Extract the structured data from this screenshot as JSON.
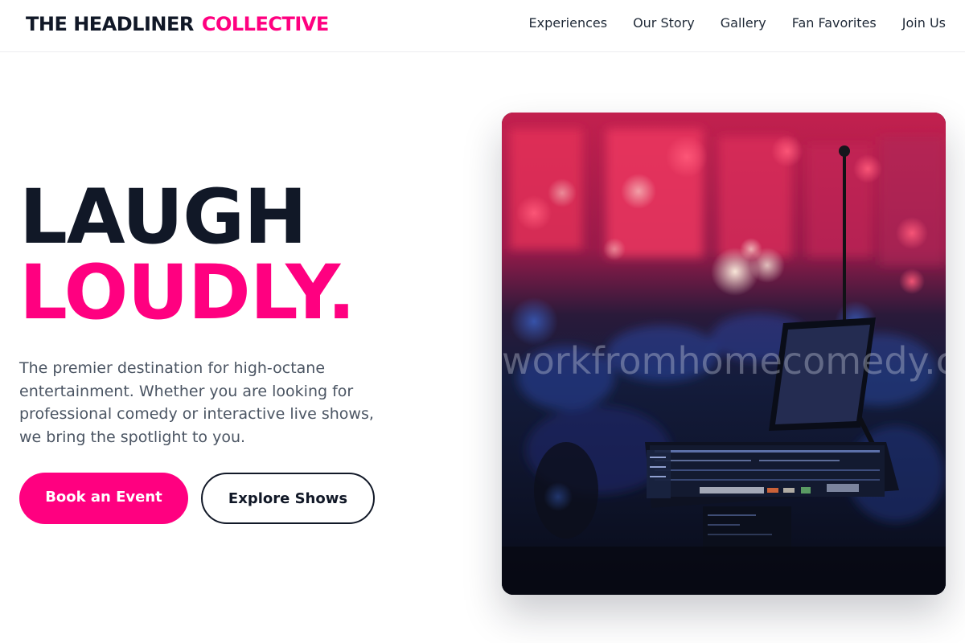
{
  "brand": {
    "name_primary": "THE HEADLINER",
    "name_accent": "COLLECTIVE",
    "accent_color": "#ff0080",
    "text_color": "#111827"
  },
  "nav": {
    "items": [
      {
        "label": "Experiences"
      },
      {
        "label": "Our Story"
      },
      {
        "label": "Gallery"
      },
      {
        "label": "Fan Favorites"
      },
      {
        "label": "Join Us"
      }
    ]
  },
  "hero": {
    "headline_line1": "LAUGH",
    "headline_line2": "LOUDLY.",
    "description": "The premier destination for high-octane entertainment. Whether you are looking for professional comedy or interactive live shows, we bring the spotlight to you.",
    "primary_button": "Book an Event",
    "secondary_button": "Explore Shows",
    "image_watermark": "workfromhomecomedy.com"
  }
}
